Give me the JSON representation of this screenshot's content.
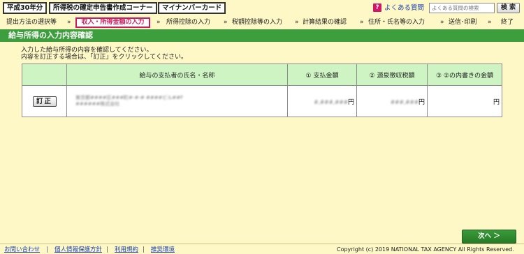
{
  "header": {
    "era_button": "平成30年分",
    "corner_button": "所得税の確定申告書作成コーナー",
    "mynumber_button": "マイナンバーカード",
    "faq_icon": "?",
    "faq_link": "よくある質問",
    "search_placeholder": "よくある質問の検索",
    "search_button": "検 索"
  },
  "steps": {
    "items": [
      "提出方法の選択等",
      "収入・所得金額の入力",
      "所得控除の入力",
      "税額控除等の入力",
      "計算結果の確認",
      "住所・氏名等の入力",
      "送信･印刷",
      "終了"
    ],
    "separator": "»",
    "current_index": 1
  },
  "title": "給与所得の入力内容確認",
  "instructions": [
    "入力した給与所得の内容を確認してください。",
    "内容を訂正する場合は、「訂正」をクリックしてください。"
  ],
  "table": {
    "headers": [
      "",
      "給与の支払者の氏名・名称",
      "① 支払金額",
      "② 源泉徴収税額",
      "③ ②の内書きの金額"
    ],
    "row": {
      "edit_button": "訂正",
      "payer_line1": "東京都####区###町#-#-# ####ビル##F",
      "payer_line2": "######株式会社",
      "payment_amount": "#,###,###",
      "withholding_tax": "###,###",
      "inner_amount": "",
      "yen": "円"
    }
  },
  "next_button": "次へ ＞",
  "footer": {
    "links": [
      "お問い合わせ",
      "個人情報保護方針",
      "利用規約",
      "推奨環境"
    ],
    "separator": "|",
    "copyright": "Copyright (c) 2019 NATIONAL TAX AGENCY All Rights Reserved."
  },
  "colors": {
    "background": "#fdf8c6",
    "title_bar": "#3c9e3c",
    "table_header": "#cdf4c2",
    "current_step": "#d01a5f",
    "link": "#1a3fb2"
  }
}
